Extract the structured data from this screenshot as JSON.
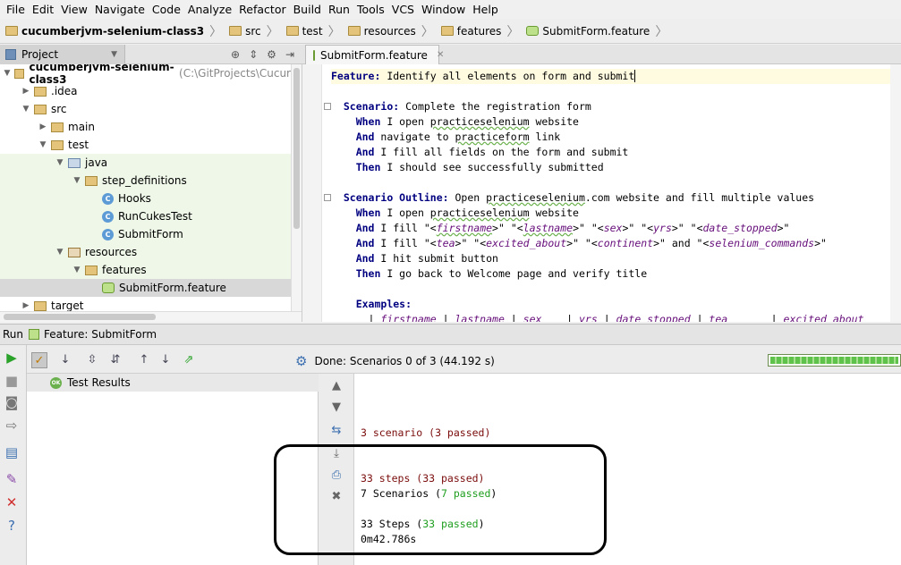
{
  "menu": [
    "File",
    "Edit",
    "View",
    "Navigate",
    "Code",
    "Analyze",
    "Refactor",
    "Build",
    "Run",
    "Tools",
    "VCS",
    "Window",
    "Help"
  ],
  "breadcrumbs": [
    "cucumberjvm-selenium-class3",
    "src",
    "test",
    "resources",
    "features",
    "SubmitForm.feature"
  ],
  "project_panel": {
    "tab_label": "Project",
    "tree": [
      {
        "label": "cucumberjvm-selenium-class3",
        "extra": "(C:\\GitProjects\\Cucur",
        "depth": 0,
        "open": true,
        "kind": "folder"
      },
      {
        "label": ".idea",
        "depth": 1,
        "open": false,
        "kind": "folder"
      },
      {
        "label": "src",
        "depth": 1,
        "open": true,
        "kind": "folder"
      },
      {
        "label": "main",
        "depth": 2,
        "open": false,
        "kind": "folder"
      },
      {
        "label": "test",
        "depth": 2,
        "open": true,
        "kind": "folder"
      },
      {
        "label": "java",
        "depth": 3,
        "open": true,
        "kind": "package",
        "green": true
      },
      {
        "label": "step_definitions",
        "depth": 4,
        "open": true,
        "kind": "folder",
        "green": true
      },
      {
        "label": "Hooks",
        "depth": 5,
        "kind": "class",
        "green": true
      },
      {
        "label": "RunCukesTest",
        "depth": 5,
        "kind": "class",
        "green": true
      },
      {
        "label": "SubmitForm",
        "depth": 5,
        "kind": "class",
        "green": true
      },
      {
        "label": "resources",
        "depth": 3,
        "open": true,
        "kind": "resource",
        "green": true
      },
      {
        "label": "features",
        "depth": 4,
        "open": true,
        "kind": "folder",
        "green": true
      },
      {
        "label": "SubmitForm.feature",
        "depth": 5,
        "kind": "feature",
        "selected": true
      },
      {
        "label": "target",
        "depth": 1,
        "open": false,
        "kind": "folder"
      }
    ]
  },
  "editor": {
    "tab_label": "SubmitForm.feature",
    "lines": [
      [
        {
          "t": "Feature:",
          "c": "kw"
        },
        {
          "t": " Identify all elements on form and submit"
        }
      ],
      [],
      [
        {
          "t": "  "
        },
        {
          "t": "Scenario:",
          "c": "kw"
        },
        {
          "t": " Complete the registration form"
        }
      ],
      [
        {
          "t": "    "
        },
        {
          "t": "When",
          "c": "kw"
        },
        {
          "t": " I open "
        },
        {
          "t": "practiceselenium",
          "c": "uw"
        },
        {
          "t": " website"
        }
      ],
      [
        {
          "t": "    "
        },
        {
          "t": "And",
          "c": "kw"
        },
        {
          "t": " navigate to "
        },
        {
          "t": "practiceform",
          "c": "uw"
        },
        {
          "t": " link"
        }
      ],
      [
        {
          "t": "    "
        },
        {
          "t": "And",
          "c": "kw"
        },
        {
          "t": " I fill all fields on the form and submit"
        }
      ],
      [
        {
          "t": "    "
        },
        {
          "t": "Then",
          "c": "kw"
        },
        {
          "t": " I should see successfully submitted"
        }
      ],
      [],
      [
        {
          "t": "  "
        },
        {
          "t": "Scenario Outline:",
          "c": "kw"
        },
        {
          "t": " Open "
        },
        {
          "t": "practiceselenium",
          "c": "uw"
        },
        {
          "t": ".com website and fill multiple values"
        }
      ],
      [
        {
          "t": "    "
        },
        {
          "t": "When",
          "c": "kw"
        },
        {
          "t": " I open "
        },
        {
          "t": "practiceselenium",
          "c": "uw"
        },
        {
          "t": " website"
        }
      ],
      [
        {
          "t": "    "
        },
        {
          "t": "And",
          "c": "kw"
        },
        {
          "t": " I fill \"<"
        },
        {
          "t": "firstname",
          "c": "ph uw"
        },
        {
          "t": ">\" \"<"
        },
        {
          "t": "lastname",
          "c": "ph uw"
        },
        {
          "t": ">\" \"<"
        },
        {
          "t": "sex",
          "c": "ph"
        },
        {
          "t": ">\" \"<"
        },
        {
          "t": "yrs",
          "c": "ph"
        },
        {
          "t": ">\" \"<"
        },
        {
          "t": "date_stopped",
          "c": "ph"
        },
        {
          "t": ">\""
        }
      ],
      [
        {
          "t": "    "
        },
        {
          "t": "And",
          "c": "kw"
        },
        {
          "t": " I fill \"<"
        },
        {
          "t": "tea",
          "c": "ph"
        },
        {
          "t": ">\" \"<"
        },
        {
          "t": "excited_about",
          "c": "ph"
        },
        {
          "t": ">\" \"<"
        },
        {
          "t": "continent",
          "c": "ph"
        },
        {
          "t": ">\" and \"<"
        },
        {
          "t": "selenium_commands",
          "c": "ph"
        },
        {
          "t": ">\""
        }
      ],
      [
        {
          "t": "    "
        },
        {
          "t": "And",
          "c": "kw"
        },
        {
          "t": " I hit submit button"
        }
      ],
      [
        {
          "t": "    "
        },
        {
          "t": "Then",
          "c": "kw"
        },
        {
          "t": " I go back to Welcome page and verify title"
        }
      ],
      [],
      [
        {
          "t": "    "
        },
        {
          "t": "Examples:",
          "c": "kw"
        }
      ],
      [
        {
          "t": "      | "
        },
        {
          "t": "firstname",
          "c": "ph"
        },
        {
          "t": " | "
        },
        {
          "t": "lastname",
          "c": "ph"
        },
        {
          "t": " | "
        },
        {
          "t": "sex",
          "c": "ph"
        },
        {
          "t": "    | "
        },
        {
          "t": "yrs",
          "c": "ph"
        },
        {
          "t": " | "
        },
        {
          "t": "date_stopped",
          "c": "ph"
        },
        {
          "t": " | "
        },
        {
          "t": "tea",
          "c": "ph"
        },
        {
          "t": "       | "
        },
        {
          "t": "excited_about",
          "c": "ph"
        }
      ]
    ]
  },
  "run_panel": {
    "header_prefix": "Run",
    "header_title": "Feature: SubmitForm",
    "status": "Done: Scenarios 0 of 3  (44.192 s)",
    "progress_fraction": 1.0,
    "results_root": "Test Results",
    "ok_badge": "OK",
    "console": [
      {
        "text": "3 scenario (3 passed)",
        "color": "red"
      },
      {
        "text": ""
      },
      {
        "text": ""
      },
      {
        "text": "33 steps (33 passed)",
        "color": "red"
      },
      {
        "text": "7 Scenarios (",
        "color": "plain",
        "tail": "7 passed",
        "tail_color": "grn",
        "end": ")"
      },
      {
        "text": ""
      },
      {
        "text": "33 Steps (",
        "color": "plain",
        "tail": "33 passed",
        "tail_color": "grn",
        "end": ")"
      },
      {
        "text": "0m42.786s",
        "color": "plain"
      }
    ]
  },
  "colors": {
    "pass_green": "#1e9e1e",
    "fail_red": "#7a0b0b",
    "keyword": "#000080"
  }
}
